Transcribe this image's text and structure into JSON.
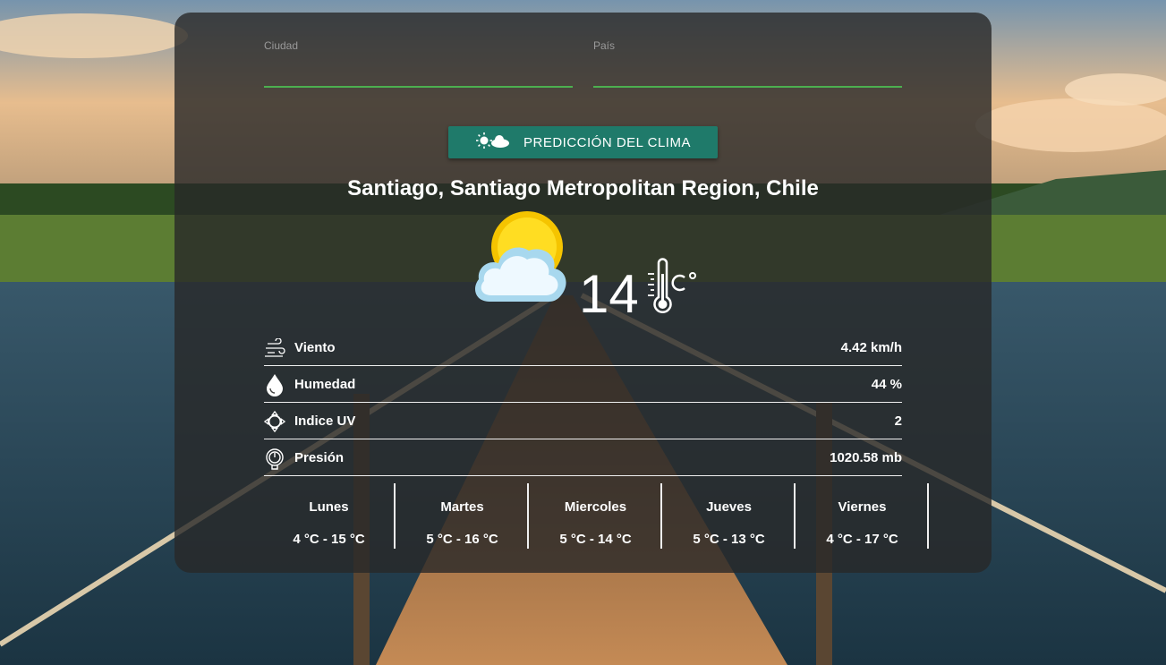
{
  "form": {
    "city_label": "Ciudad",
    "city_value": "",
    "country_label": "País",
    "country_value": ""
  },
  "button": {
    "label": "PREDICCIÓN DEL CLIMA",
    "icon": "sun-cloud-icon"
  },
  "location": "Santiago, Santiago Metropolitan Region, Chile",
  "current": {
    "icon": "partly-cloudy-icon",
    "temperature": "14",
    "unit_icon": "thermometer-celsius-icon"
  },
  "details": [
    {
      "icon": "wind-icon",
      "label": "Viento",
      "value": "4.42 km/h"
    },
    {
      "icon": "humidity-drop-icon",
      "label": "Humedad",
      "value": "44 %"
    },
    {
      "icon": "uv-sun-icon",
      "label": "Indice UV",
      "value": "2"
    },
    {
      "icon": "barometer-icon",
      "label": "Presión",
      "value": "1020.58 mb"
    }
  ],
  "forecast": [
    {
      "day": "Lunes",
      "range": "4 °C - 15 °C"
    },
    {
      "day": "Martes",
      "range": "5 °C - 16 °C"
    },
    {
      "day": "Miercoles",
      "range": "5 °C - 14 °C"
    },
    {
      "day": "Jueves",
      "range": "5 °C - 13 °C"
    },
    {
      "day": "Viernes",
      "range": "4 °C - 17 °C"
    }
  ],
  "colors": {
    "accent_green": "#4caf50",
    "button_teal": "#1f7a6a"
  }
}
